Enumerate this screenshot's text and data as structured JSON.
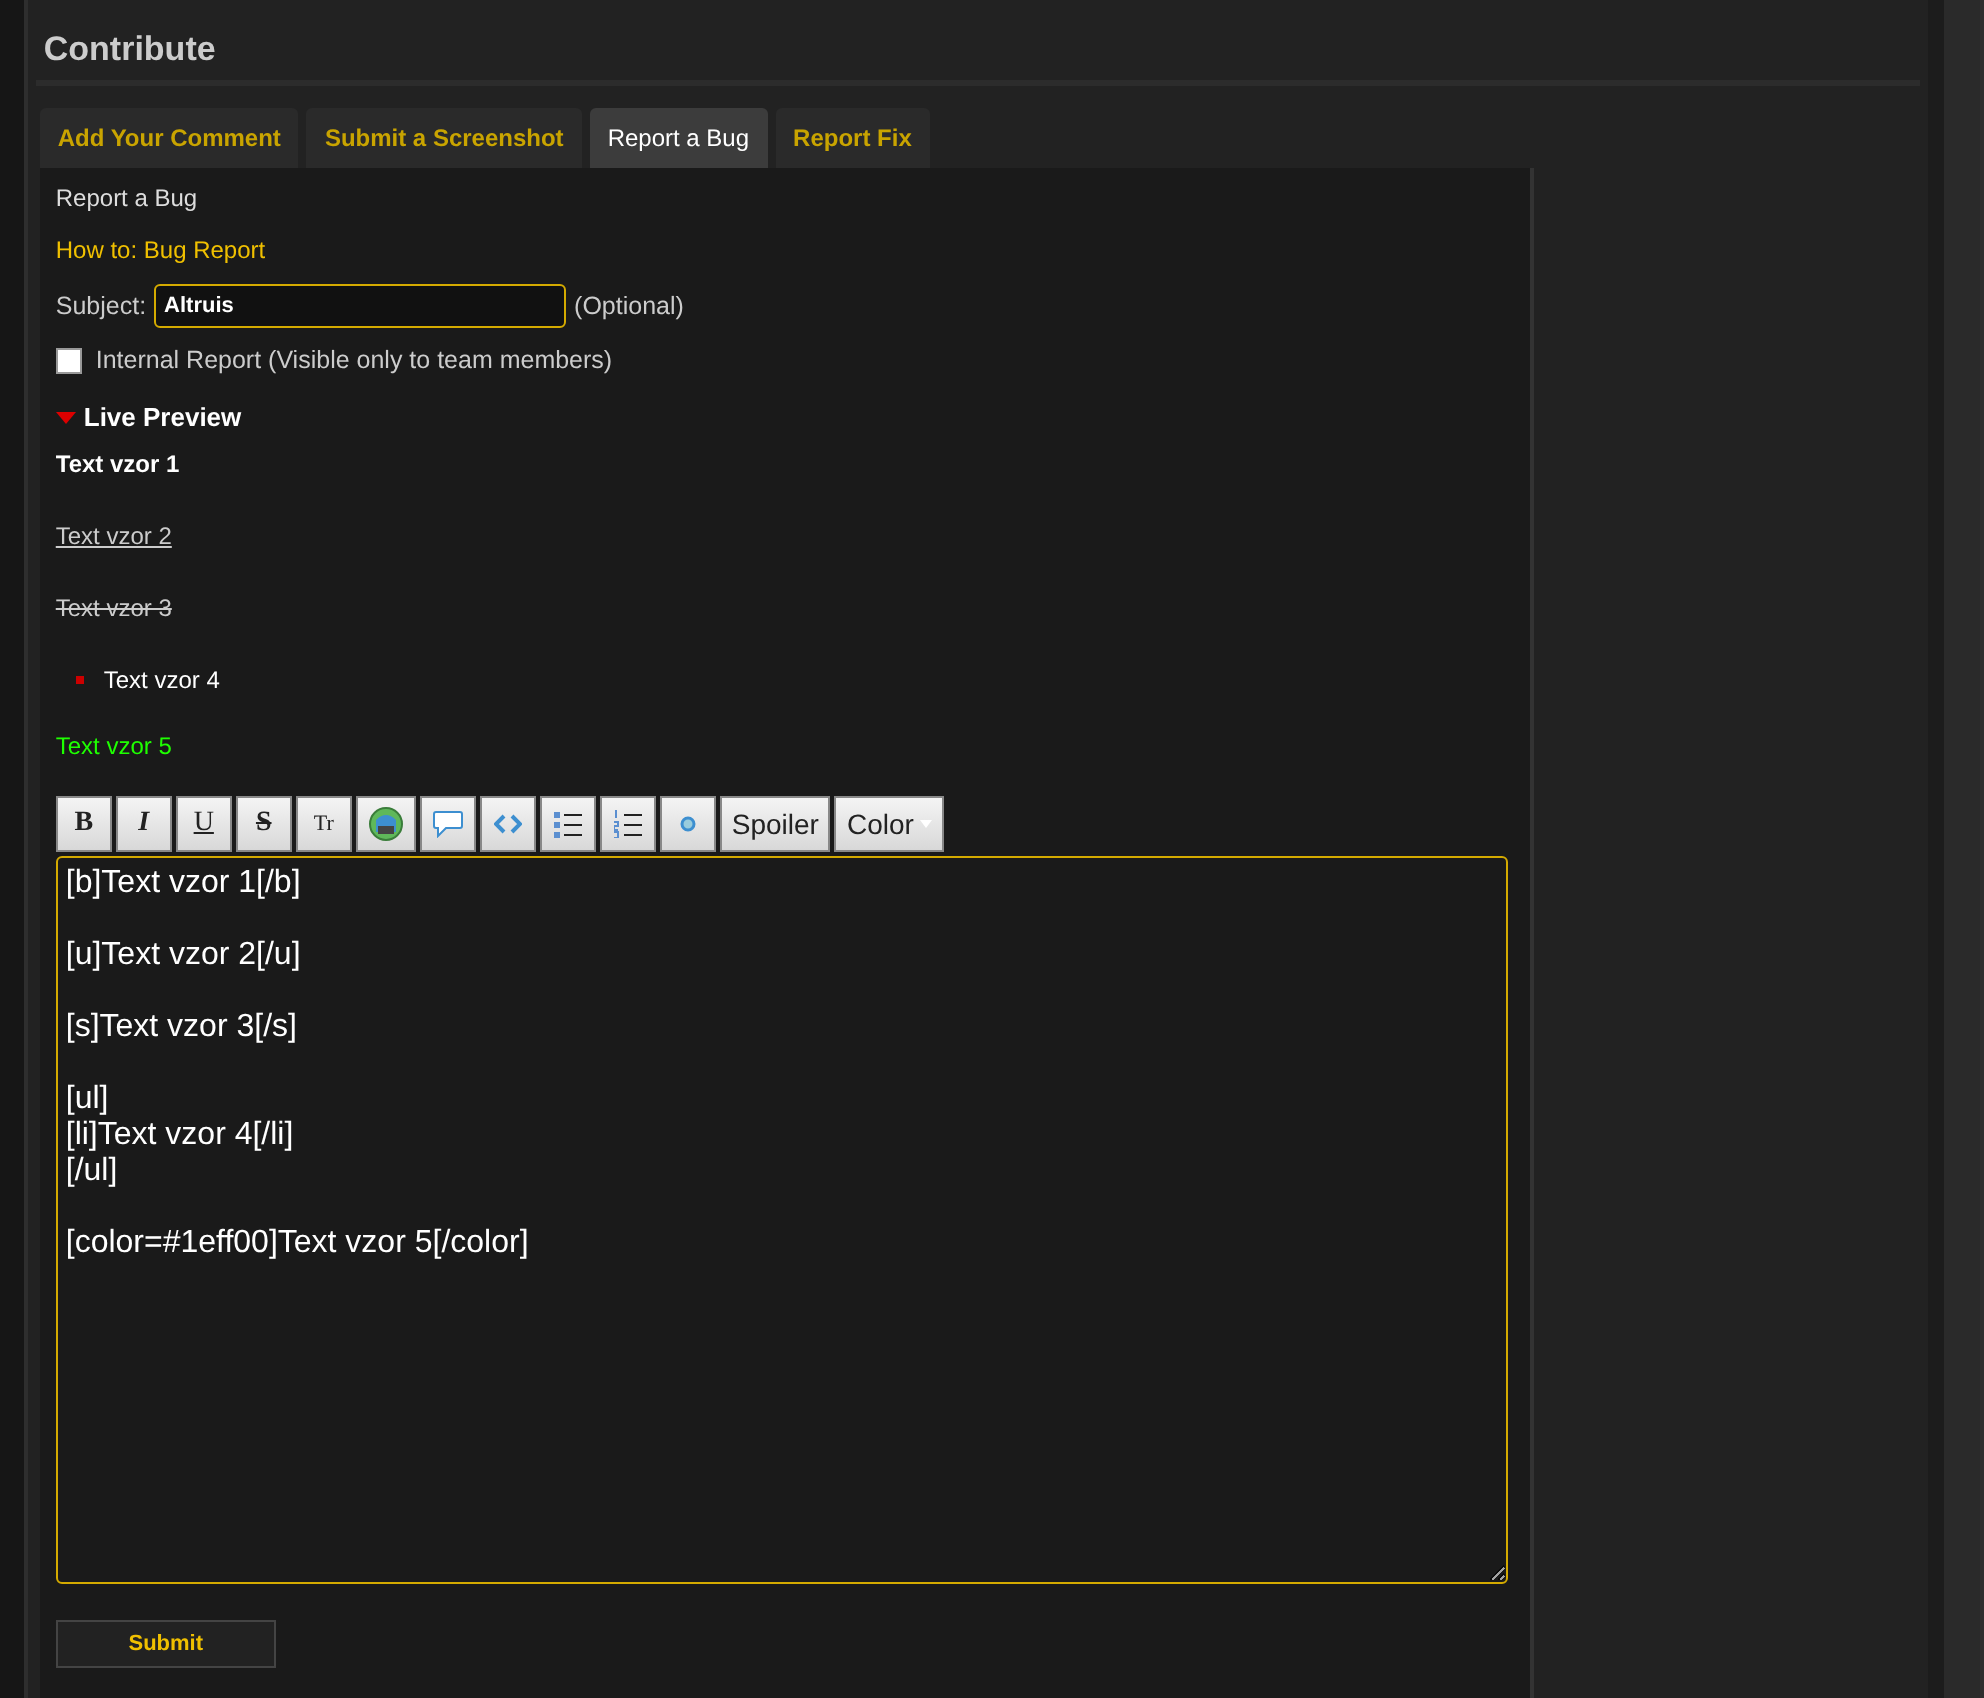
{
  "section": {
    "title": "Contribute"
  },
  "tabs": [
    {
      "label": "Add Your Comment",
      "selected": false
    },
    {
      "label": "Submit a Screenshot",
      "selected": false
    },
    {
      "label": "Report a Bug",
      "selected": true
    },
    {
      "label": "Report Fix",
      "selected": false
    }
  ],
  "form": {
    "heading": "Report a Bug",
    "howto_link": "How to: Bug Report",
    "subject": {
      "label": "Subject:",
      "value": "Altruis",
      "note": "(Optional)"
    },
    "internal": {
      "label": "Internal Report (Visible only to team members)",
      "checked": false
    },
    "preview": {
      "title": "Live Preview",
      "expanded": true,
      "items": [
        {
          "kind": "bold",
          "text": "Text vzor 1"
        },
        {
          "kind": "underline",
          "text": "Text vzor 2"
        },
        {
          "kind": "strike",
          "text": "Text vzor 3"
        },
        {
          "kind": "bullet",
          "text": "Text vzor 4"
        },
        {
          "kind": "color",
          "text": "Text vzor 5",
          "color": "#1eff00"
        }
      ]
    },
    "toolbar": [
      {
        "kind": "bold",
        "label": "B"
      },
      {
        "kind": "italic",
        "label": "I"
      },
      {
        "kind": "underline",
        "label": "U"
      },
      {
        "kind": "strike",
        "label": "S"
      },
      {
        "kind": "size",
        "label": "Tr"
      },
      {
        "kind": "image"
      },
      {
        "kind": "quote"
      },
      {
        "kind": "code"
      },
      {
        "kind": "list"
      },
      {
        "kind": "numbered-list"
      },
      {
        "kind": "item"
      },
      {
        "kind": "text",
        "label": "Spoiler"
      },
      {
        "kind": "dropdown",
        "label": "Color"
      }
    ],
    "editor": {
      "value": "[b]Text vzor 1[/b]\n\n[u]Text vzor 2[/u]\n\n[s]Text vzor 3[/s]\n\n[ul]\n[li]Text vzor 4[/li]\n[/ul]\n\n[color=#1eff00]Text vzor 5[/color]"
    },
    "submit": "Submit"
  }
}
